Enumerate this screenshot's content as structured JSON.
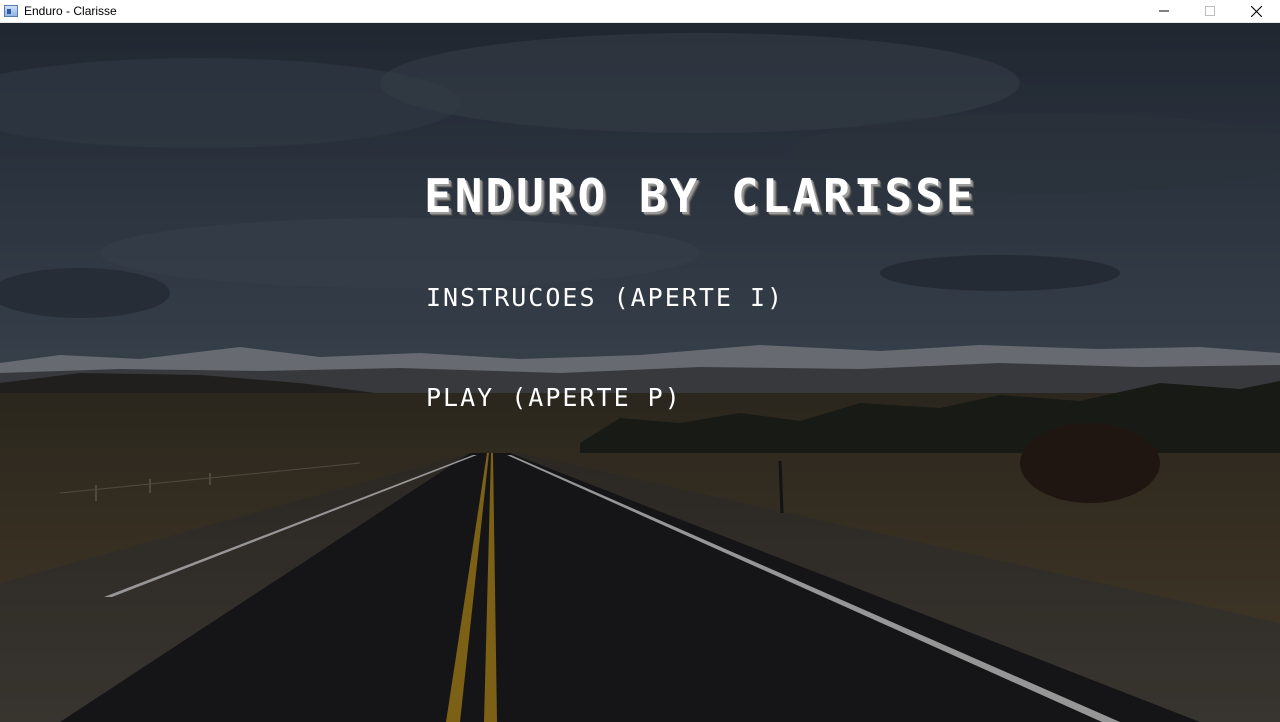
{
  "window": {
    "title": "Enduro - Clarisse",
    "controls": [
      "minimize-icon",
      "maximize-icon",
      "close-icon"
    ]
  },
  "menu": {
    "title": "ENDURO BY CLARISSE",
    "instructions": "INSTRUCOES (APERTE I)",
    "play": "PLAY (APERTE P)"
  },
  "colors": {
    "text": "#ffffff",
    "sky": "#3e4a58",
    "road": "#1c1c1f",
    "center_line": "#b08a1e",
    "grass": "#4a4030"
  }
}
